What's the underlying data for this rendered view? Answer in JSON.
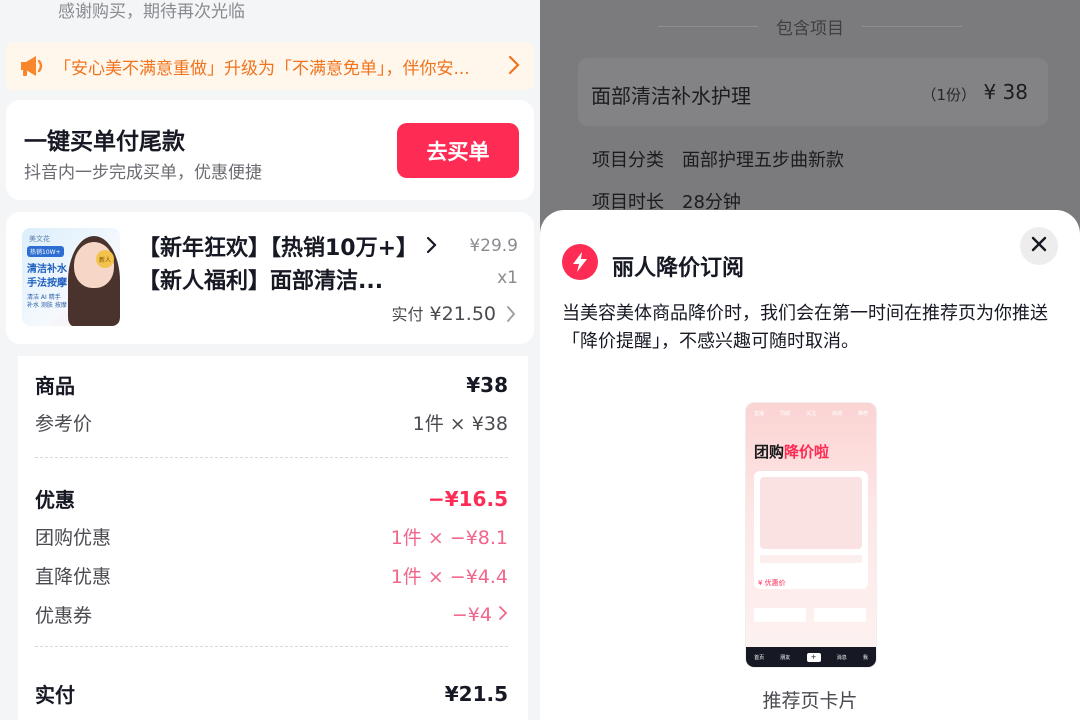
{
  "left": {
    "thanks_text": "感谢购买，期待再次光临",
    "notice": {
      "text": "「安心美不满意重做」升级为「不满意免单」，伴你安...",
      "icon": "megaphone-icon"
    },
    "pay_card": {
      "title": "一键买单付尾款",
      "subtitle": "抖音内一步完成买单，优惠便捷",
      "button_label": "去买单"
    },
    "product": {
      "thumb": {
        "brand": "美文花",
        "badge": "热销10W+",
        "line1": "清洁补水",
        "line2": "手法按摩",
        "tag": "新人",
        "chips": "清洁 AI 精手\n补水 测肤 按摩"
      },
      "name_line1": "【新年狂欢】【热销10万+】",
      "name_line2": "【新人福利】面部清洁...",
      "original_price": "¥29.9",
      "quantity": "x1",
      "paid_label": "实付",
      "paid_amount": "¥21.50"
    },
    "detail": {
      "goods_label": "商品",
      "goods_value": "¥38",
      "ref_label": "参考价",
      "ref_value": "1件 × ¥38",
      "discount_label": "优惠",
      "discount_value": "−¥16.5",
      "group_label": "团购优惠",
      "group_value": "1件 × −¥8.1",
      "direct_label": "直降优惠",
      "direct_value": "1件 × −¥4.4",
      "coupon_label": "优惠券",
      "coupon_value": "−¥4",
      "actual_label": "实付",
      "actual_value": "¥21.5"
    }
  },
  "right": {
    "section_title": "包含项目",
    "item": {
      "name": "面部清洁补水护理",
      "count": "（1份）",
      "price": "¥ 38"
    },
    "meta": [
      {
        "key": "项目分类",
        "value": "面部护理五步曲新款"
      },
      {
        "key": "项目时长",
        "value": "28分钟"
      }
    ],
    "sheet": {
      "title": "丽人降价订阅",
      "description": "当美容美体商品降价时，我们会在第一时间在推荐页为你推送「降价提醒」，不感兴趣可随时取消。",
      "phone": {
        "status_items": [
          "直播",
          "同城",
          "关注",
          "商城",
          "推荐"
        ],
        "heading_normal": "团购",
        "heading_highlight": "降价啦",
        "price_label": "¥ 优惠价",
        "nav_items": [
          "首页",
          "朋友",
          "+",
          "消息",
          "我"
        ]
      },
      "caption": "推荐页卡片"
    }
  },
  "colors": {
    "accent": "#fe2c55",
    "discount_pink": "#f2668b",
    "notice_orange": "#f0741e",
    "overlay_gray": "#7b7b7d"
  }
}
